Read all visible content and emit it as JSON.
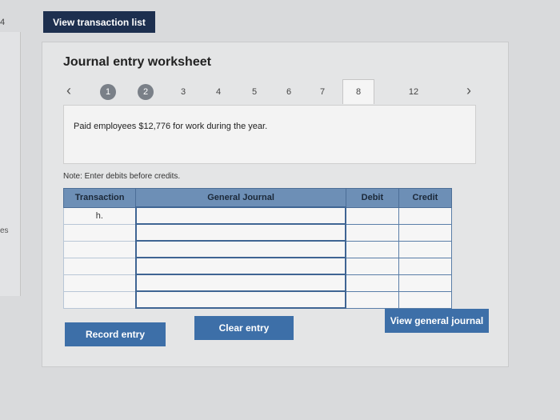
{
  "outer": {
    "left_number": "4",
    "left_fragment": "es"
  },
  "header": {
    "view_transaction_list": "View transaction list"
  },
  "worksheet": {
    "title": "Journal entry worksheet",
    "steps": [
      "1",
      "2",
      "3",
      "4",
      "5",
      "6",
      "7",
      "8",
      "12"
    ],
    "current_step": "8",
    "description": "Paid employees $12,776 for work during the year.",
    "note": "Note: Enter debits before credits."
  },
  "table": {
    "headers": {
      "transaction": "Transaction",
      "journal": "General Journal",
      "debit": "Debit",
      "credit": "Credit"
    },
    "rows": [
      {
        "transaction": "h.",
        "journal": "",
        "debit": "",
        "credit": ""
      },
      {
        "transaction": "",
        "journal": "",
        "debit": "",
        "credit": ""
      },
      {
        "transaction": "",
        "journal": "",
        "debit": "",
        "credit": ""
      },
      {
        "transaction": "",
        "journal": "",
        "debit": "",
        "credit": ""
      },
      {
        "transaction": "",
        "journal": "",
        "debit": "",
        "credit": ""
      },
      {
        "transaction": "",
        "journal": "",
        "debit": "",
        "credit": ""
      }
    ]
  },
  "buttons": {
    "record": "Record entry",
    "clear": "Clear entry",
    "view_journal": "View general journal"
  }
}
